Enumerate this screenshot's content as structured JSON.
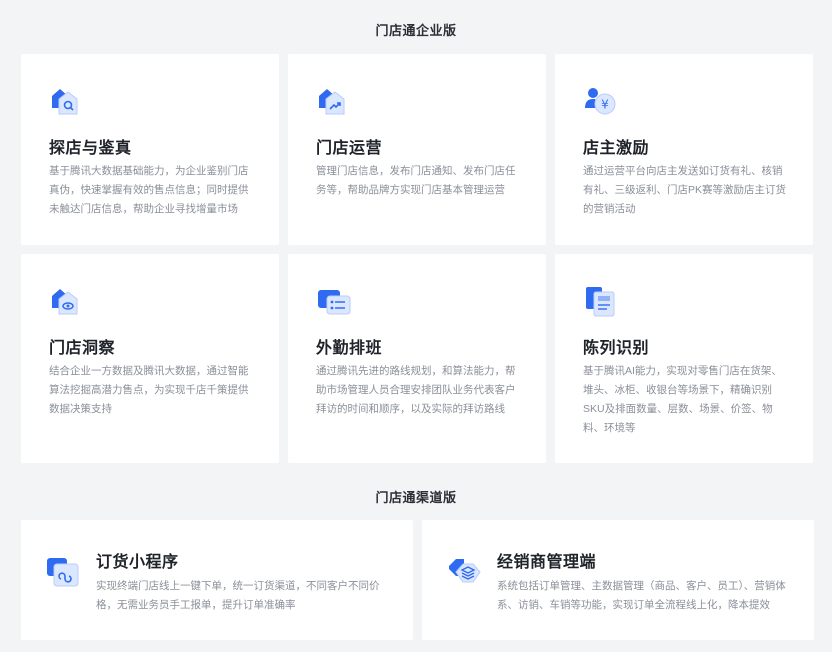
{
  "enterprise": {
    "title": "门店通企业版",
    "cards": [
      {
        "icon": "shop-search-icon",
        "title": "探店与鉴真",
        "desc": [
          "基于腾讯大数据基础能力，为企业鉴别门店",
          "真伪，快速掌握有效的售点信息；同时提供",
          "未触达门店信息，帮助企业寻找增量市场"
        ]
      },
      {
        "icon": "shop-growth-icon",
        "title": "门店运营",
        "desc": [
          "管理门店信息，发布门店通知、发布门店任",
          "务等，帮助品牌方实现门店基本管理运营"
        ]
      },
      {
        "icon": "owner-reward-icon",
        "title": "店主激励",
        "desc": [
          "通过运营平台向店主发送如订货有礼、核销",
          "有礼、三级返利、门店PK赛等激励店主订货",
          "的营销活动"
        ]
      },
      {
        "icon": "shop-insight-icon",
        "title": "门店洞察",
        "desc": [
          "结合企业一方数据及腾讯大数据，通过智能",
          "算法挖掘高潜力售点，为实现千店千策提供",
          "数据决策支持"
        ]
      },
      {
        "icon": "schedule-card-icon",
        "title": "外勤排班",
        "desc": [
          "通过腾讯先进的路线规划，和算法能力，帮",
          "助市场管理人员合理安排团队业务代表客户",
          "拜访的时间和顺序，以及实际的拜访路线"
        ]
      },
      {
        "icon": "display-recognition-icon",
        "title": "陈列识别",
        "desc": [
          "基于腾讯AI能力，实现对零售门店在货架、",
          "堆头、冰柜、收银台等场景下，精确识别",
          "SKU及排面数量、层数、场景、价签、物",
          "料、环境等"
        ]
      }
    ]
  },
  "channel": {
    "title": "门店通渠道版",
    "cards": [
      {
        "icon": "order-miniapp-icon",
        "title": "订货小程序",
        "desc": [
          "实现终端门店线上一键下单，统一订货渠道，不同客户不同价",
          "格，无需业务员手工报单，提升订单准确率"
        ]
      },
      {
        "icon": "distributor-layers-icon",
        "title": "经销商管理端",
        "desc": [
          "系统包括订单管理、主数据管理（商品、客户、员工）、营销体",
          "系、访销、车销等功能，实现订单全流程线上化，降本提效"
        ]
      }
    ]
  },
  "colors": {
    "primary": "#2f6bf0",
    "light": "#dbe7ff",
    "mid": "#8fb2fb"
  }
}
